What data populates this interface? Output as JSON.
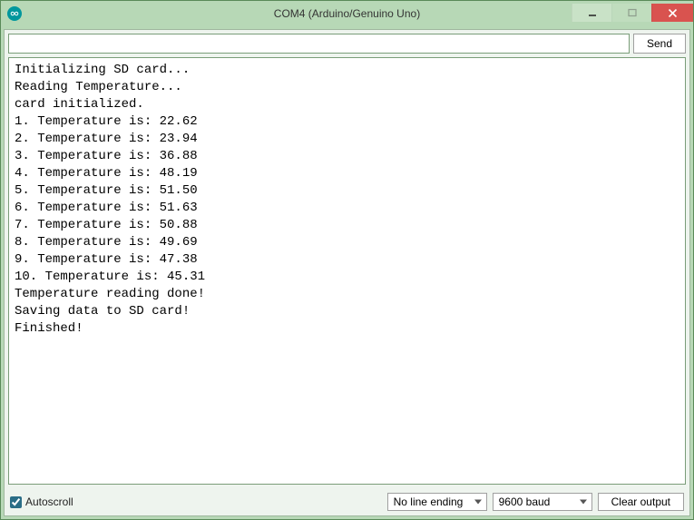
{
  "window": {
    "title": "COM4 (Arduino/Genuino Uno)"
  },
  "toolbar": {
    "send_label": "Send",
    "input_value": ""
  },
  "output": {
    "intro": [
      "Initializing SD card...",
      "Reading Temperature...",
      "card initialized."
    ],
    "readings": [
      {
        "n": 1,
        "value": "22.62"
      },
      {
        "n": 2,
        "value": "23.94"
      },
      {
        "n": 3,
        "value": "36.88"
      },
      {
        "n": 4,
        "value": "48.19"
      },
      {
        "n": 5,
        "value": "51.50"
      },
      {
        "n": 6,
        "value": "51.63"
      },
      {
        "n": 7,
        "value": "50.88"
      },
      {
        "n": 8,
        "value": "49.69"
      },
      {
        "n": 9,
        "value": "47.38"
      },
      {
        "n": 10,
        "value": "45.31"
      }
    ],
    "reading_template": "{n}. Temperature is: {value}",
    "outro": [
      "Temperature reading done!",
      "Saving data to SD card!",
      "Finished!"
    ]
  },
  "footer": {
    "autoscroll_label": "Autoscroll",
    "autoscroll_checked": true,
    "line_ending": "No line ending",
    "baud": "9600 baud",
    "clear_label": "Clear output"
  }
}
